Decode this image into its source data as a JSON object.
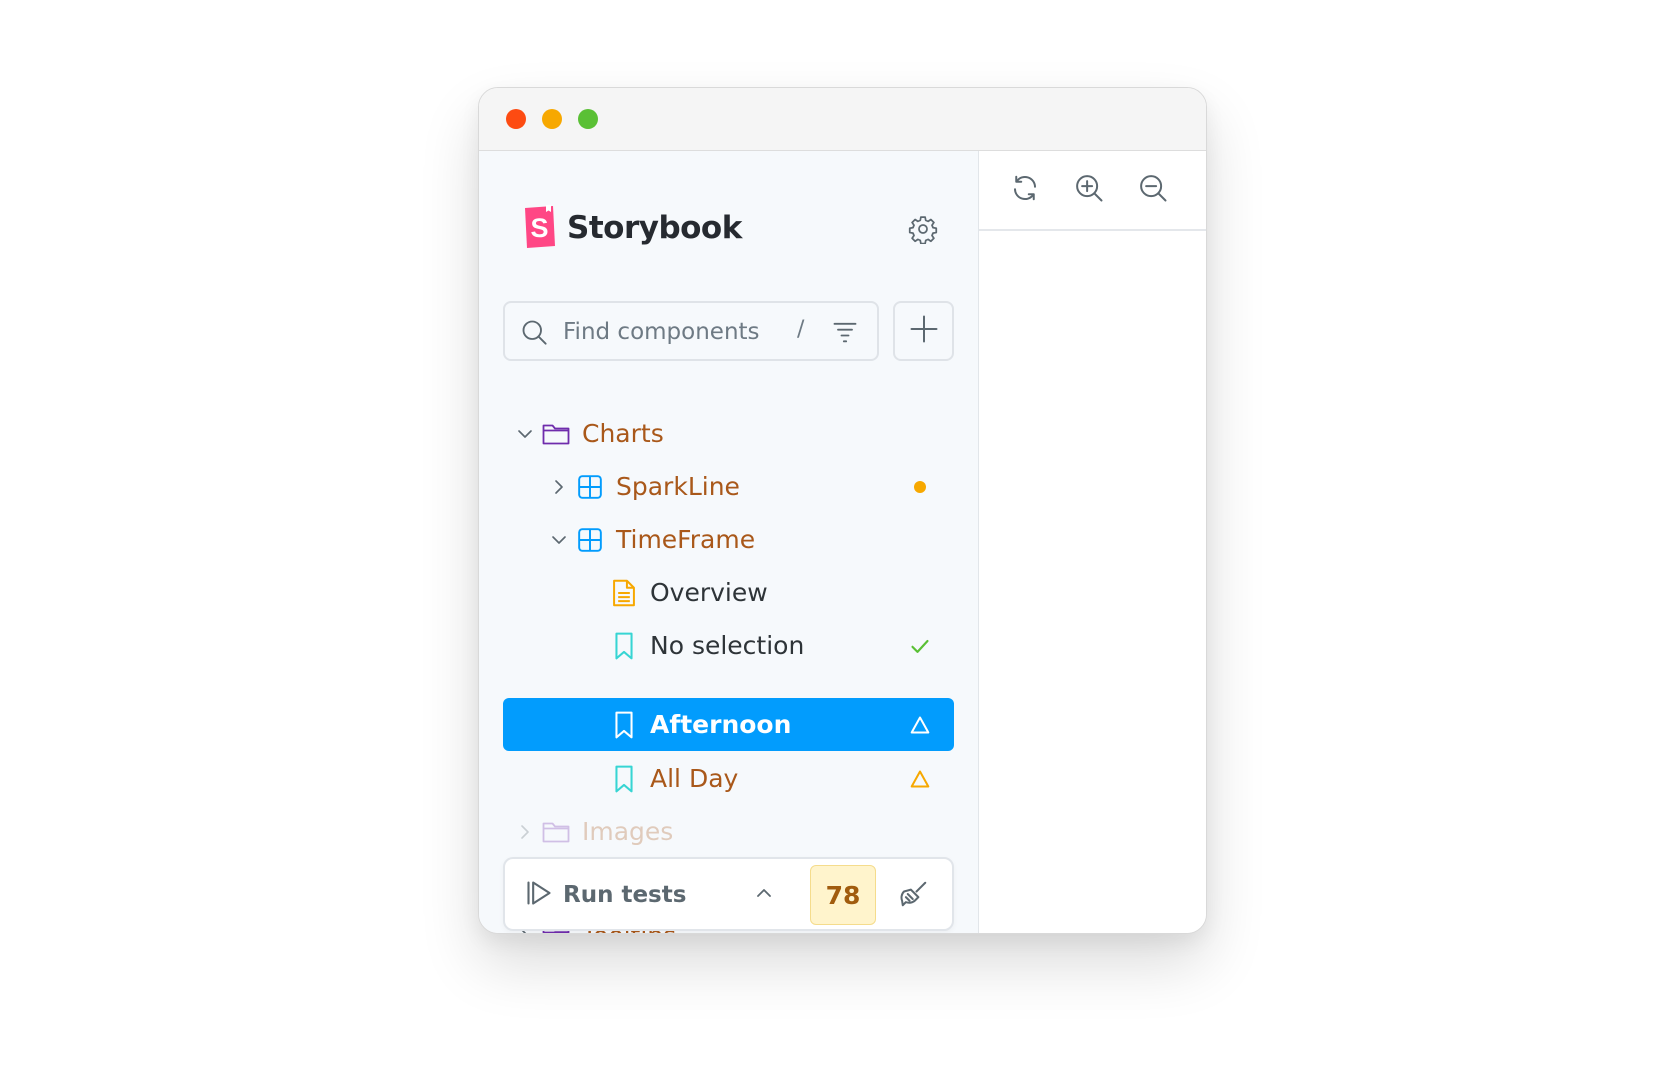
{
  "window": {
    "traffic_lights": [
      "close",
      "minimize",
      "zoom"
    ]
  },
  "sidebar": {
    "brand": {
      "name": "Storybook",
      "logo_letter": "S",
      "logo_color": "#ff4785"
    },
    "search": {
      "placeholder": "Find components",
      "shortcut": "/"
    },
    "tree": [
      {
        "label": "Charts",
        "type": "group",
        "expanded": true,
        "icon": "folder-icon"
      },
      {
        "label": "SparkLine",
        "type": "component",
        "expanded": false,
        "icon": "component-icon",
        "status": "pending"
      },
      {
        "label": "TimeFrame",
        "type": "component",
        "expanded": true,
        "icon": "component-icon"
      },
      {
        "label": "Overview",
        "type": "docs",
        "icon": "document-icon"
      },
      {
        "label": "No selection",
        "type": "story",
        "icon": "bookmark-icon",
        "status": "success"
      },
      {
        "label": "Afternoon",
        "type": "story",
        "icon": "bookmark-icon",
        "status": "warning",
        "selected": true
      },
      {
        "label": "All Day",
        "type": "story",
        "icon": "bookmark-icon",
        "status": "warning"
      },
      {
        "label": "Images",
        "type": "group",
        "expanded": false,
        "icon": "folder-icon"
      },
      {
        "label": "Tooltips",
        "type": "group",
        "expanded": false,
        "icon": "folder-icon"
      }
    ],
    "testing": {
      "run_label": "Run tests",
      "count": "78"
    }
  },
  "toolbar": {
    "buttons": [
      "reload-icon",
      "zoom-in-icon",
      "zoom-out-icon"
    ]
  },
  "colors": {
    "accent": "#029cfd",
    "component_text": "#a9581a",
    "warning": "#f7a800",
    "success": "#5ac035",
    "folder": "#6f2cac",
    "component_icon": "#029cfd",
    "story_icon": "#37d5d3"
  }
}
